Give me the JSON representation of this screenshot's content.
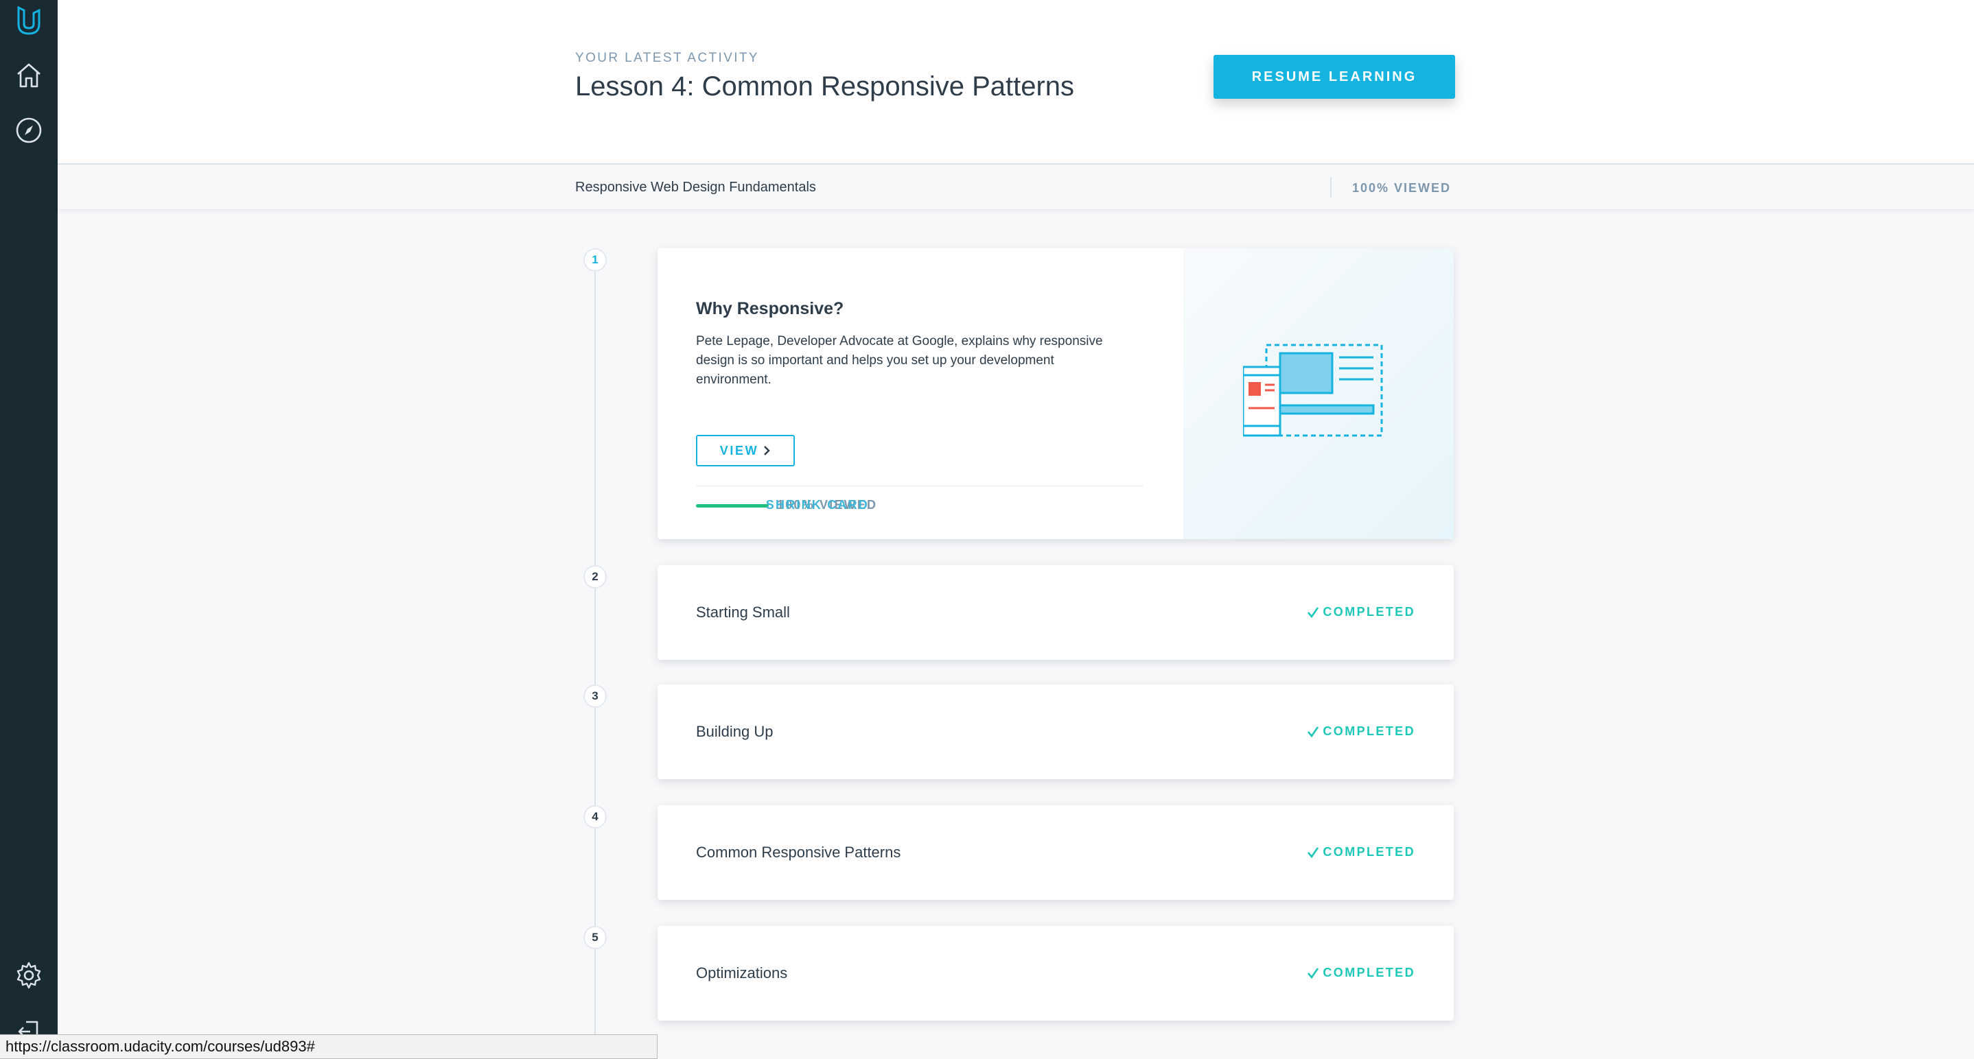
{
  "header": {
    "eyebrow": "YOUR LATEST ACTIVITY",
    "lesson_title": "Lesson 4: Common Responsive Patterns",
    "resume_label": "RESUME LEARNING"
  },
  "subbar": {
    "course_name": "Responsive Web Design Fundamentals",
    "viewed": "100% VIEWED"
  },
  "sidebar": {
    "icons": [
      "udacity-logo-icon",
      "home-icon",
      "compass-icon",
      "gear-icon",
      "logout-icon"
    ]
  },
  "concepts": [
    {
      "number": "1",
      "title": "Why Responsive?",
      "description": "Pete Lepage, Developer Advocate at Google, explains why responsive design is so important and helps you set up your development environment.",
      "view_label": "VIEW",
      "viewed_label": "100% VIEWED",
      "progress": 1.0,
      "shrink_label": "SHRINK CARD"
    },
    {
      "number": "2",
      "title": "Starting Small",
      "status": "COMPLETED"
    },
    {
      "number": "3",
      "title": "Building Up",
      "status": "COMPLETED"
    },
    {
      "number": "4",
      "title": "Common Responsive Patterns",
      "status": "COMPLETED"
    },
    {
      "number": "5",
      "title": "Optimizations",
      "status": "COMPLETED"
    }
  ],
  "status_url": "https://classroom.udacity.com/courses/ud893#",
  "colors": {
    "sidebar": "#1a2a33",
    "accent": "#15b3e0",
    "completed": "#1ec8b8",
    "progress": "#1fbf7f"
  }
}
